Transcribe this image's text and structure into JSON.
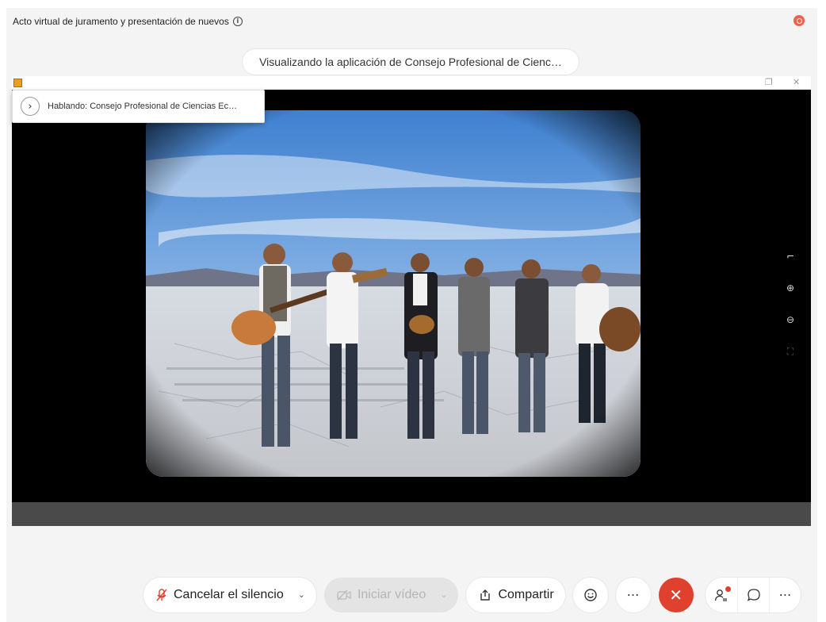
{
  "meeting": {
    "title": "Acto virtual de juramento y presentación de nuevos",
    "viewing_banner": "Visualizando la aplicación de Consejo Profesional de Cienc…",
    "speaker": "Hablando: Consejo Profesional de Ciencias Ec…"
  },
  "toolbar": {
    "unmute_label": "Cancelar el silencio",
    "video_label": "Iniciar vídeo",
    "share_label": "Compartir"
  },
  "icons": {
    "info": "info-icon",
    "recording": "recording-icon",
    "mic_muted": "mic-muted-icon",
    "video_off": "video-off-icon",
    "share": "share-icon",
    "reactions": "smiley-icon",
    "more": "more-icon",
    "end_call": "close-icon",
    "participants": "participants-icon",
    "chat": "chat-icon"
  },
  "colors": {
    "end_call": "#e0402e",
    "recording": "#f0604a",
    "muted_mic": "#e0402e"
  }
}
